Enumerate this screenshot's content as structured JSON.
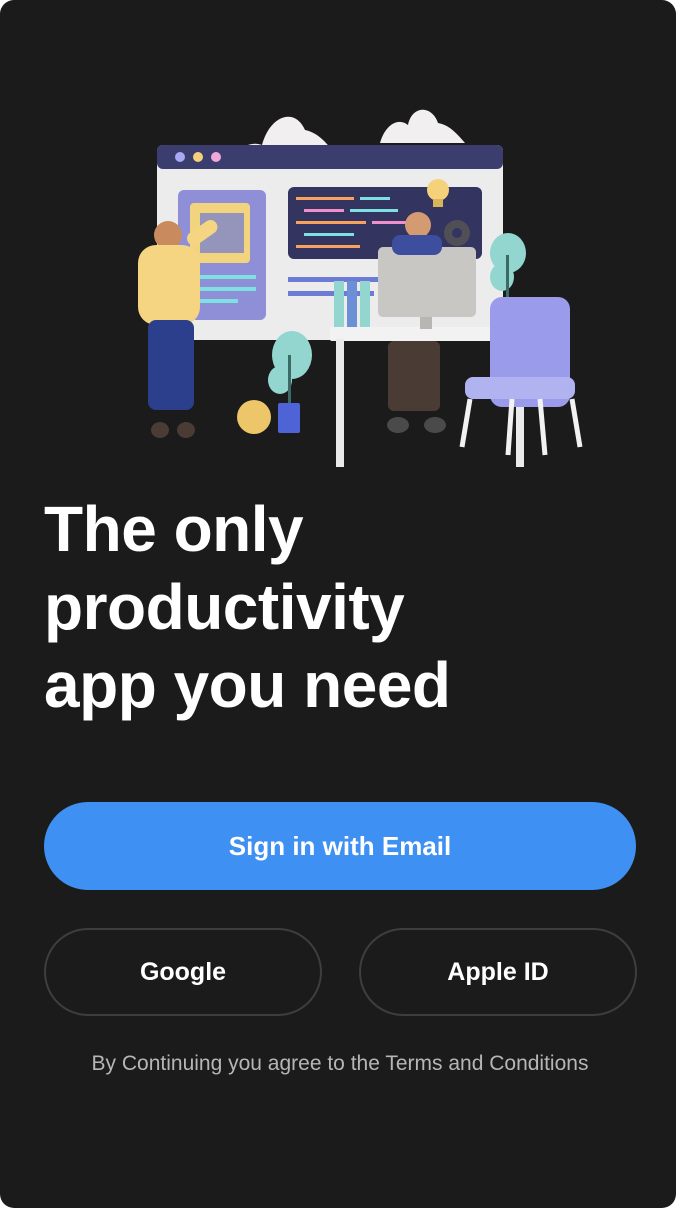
{
  "headline": {
    "line1": "The only",
    "line2": "productivity",
    "line3": "app you need"
  },
  "buttons": {
    "email": "Sign in with Email",
    "google": "Google",
    "apple": "Apple ID"
  },
  "terms": "By Continuing you agree to the Terms and Conditions",
  "colors": {
    "background": "#1b1b1b",
    "primary": "#3f90f3",
    "outline": "#3e3e3e",
    "terms_text": "#b6b6b6"
  }
}
